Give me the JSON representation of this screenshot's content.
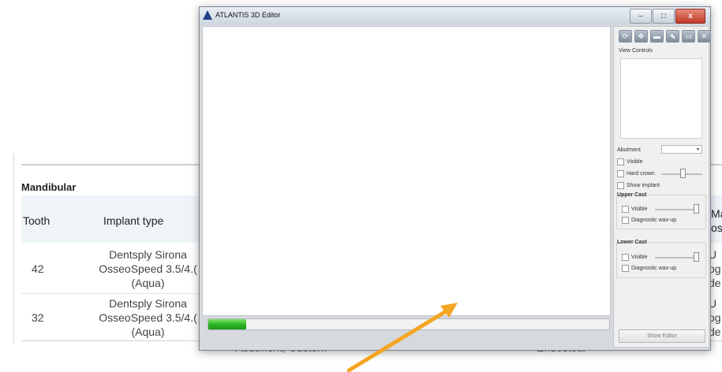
{
  "background_page": {
    "section_title": "Mandibular",
    "columns": [
      "Tooth",
      "Implant type",
      "Ma",
      "os"
    ],
    "rows": [
      {
        "tooth": "42",
        "implant_line1": "Dentsply Sirona",
        "implant_line2": "OsseoSpeed 3.5/4.(",
        "implant_line3": "(Aqua)",
        "edge_lines": [
          "U",
          "og",
          "de"
        ]
      },
      {
        "tooth": "32",
        "implant_line1": "Dentsply Sirona",
        "implant_line2": "OsseoSpeed 3.5/4.(",
        "implant_line3": "(Aqua)",
        "edge_lines": [
          "U",
          "og",
          "de"
        ]
      }
    ],
    "hidden_fragments": [
      "Abutment, Custom",
      "Endosteal"
    ]
  },
  "window": {
    "title": "ATLANTIS 3D Editor",
    "controls": {
      "minimize": "–",
      "maximize": "□",
      "close": "x"
    }
  },
  "progress": {
    "value": 0.095,
    "color": "#28b420"
  },
  "side_panel": {
    "toolbar_icons": [
      "rotate-icon",
      "pan-icon",
      "zoom-icon",
      "select-icon",
      "view-icon",
      "clip-icon"
    ],
    "view_controls_label": "View Controls",
    "abutment_label": "Abutment",
    "abutment_value": "",
    "visible_label": "Visible",
    "hard_crown_label": "Hard crown",
    "show_implant_label": "Show implant",
    "upper_cast_label": "Upper Cast",
    "upper_visible_label": "Visible",
    "upper_wax_label": "Diagnostic wax-up",
    "lower_cast_label": "Lower Cast",
    "lower_visible_label": "Visible",
    "lower_wax_label": "Diagnostic wax-up",
    "show_editor_label": "Show Editor"
  },
  "colors": {
    "arrow": "#f4a623",
    "title_bar": "#cdd6e0",
    "panel": "#f0f0f0"
  }
}
